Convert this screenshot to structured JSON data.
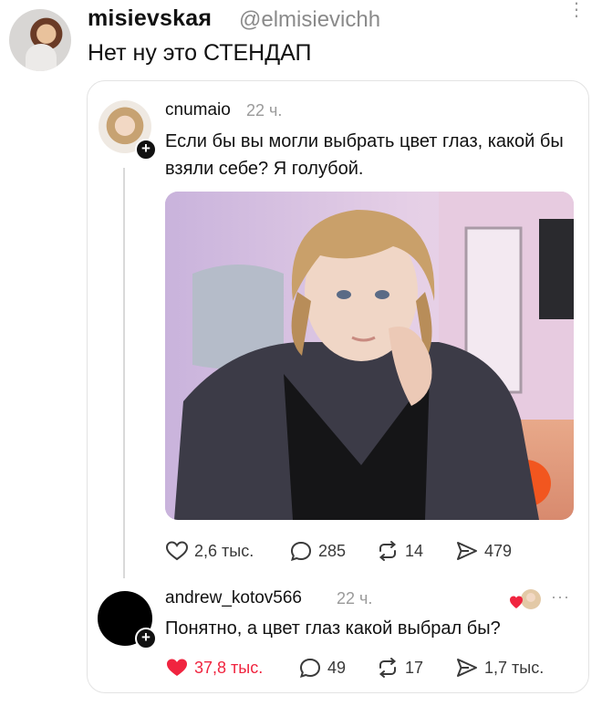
{
  "outer_post": {
    "display_name": "misievskaя",
    "handle": "@elmisievichh",
    "text": "Нет ну это СТЕНДАП",
    "more_glyph": "⋮"
  },
  "quoted_post": {
    "username": "cnumaio",
    "time": "22 ч.",
    "text": "Если бы вы могли выбрать цвет глаз, какой бы взяли себе? Я голубой.",
    "actions": {
      "likes": "2,6 тыс.",
      "replies": "285",
      "reposts": "14",
      "shares": "479"
    }
  },
  "reply": {
    "username": "andrew_kotov566",
    "time": "22 ч.",
    "text": "Понятно, а цвет глаз какой выбрал бы?",
    "more_glyph": "···",
    "actions": {
      "likes": "37,8 тыс.",
      "replies": "49",
      "reposts": "17",
      "shares": "1,7 тыс."
    }
  },
  "colors": {
    "like_active": "#f0243f",
    "muted_text": "#9a9a9a",
    "card_border": "#e3e3e3"
  },
  "icons": [
    "heart-icon",
    "reply-icon",
    "repost-icon",
    "share-icon",
    "plus-icon",
    "more-icon"
  ]
}
